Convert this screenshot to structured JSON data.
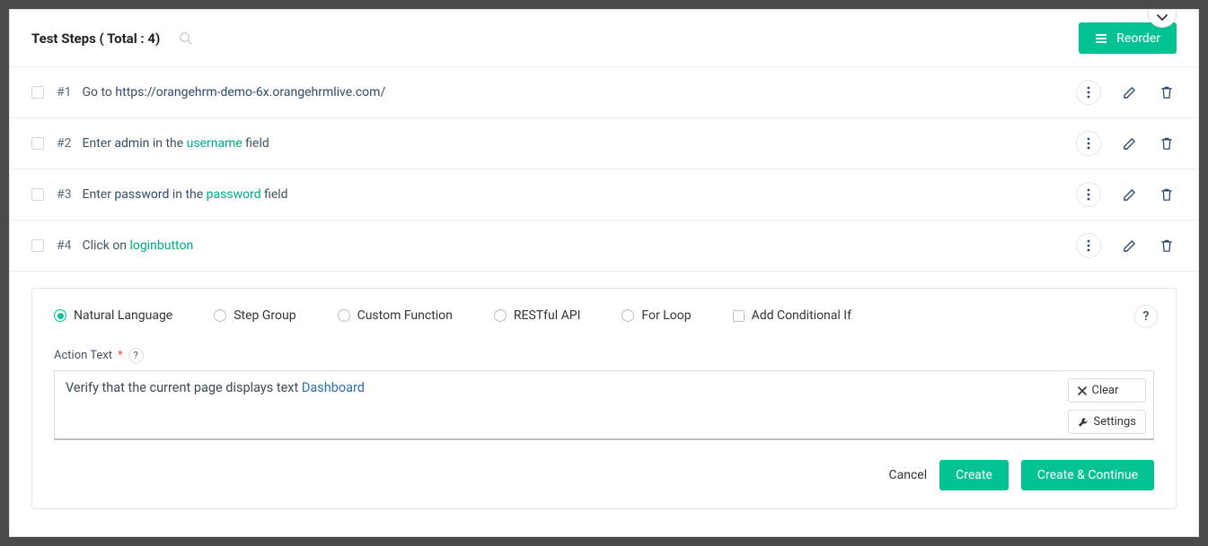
{
  "header": {
    "title": "Test Steps ( Total : 4)",
    "reorder_label": "Reorder"
  },
  "steps": [
    {
      "num": "#1",
      "pre": "Go to ",
      "link": "https://orangehrm-demo-6x.orangehrmlive.com/",
      "mid": "",
      "field": "",
      "post": ""
    },
    {
      "num": "#2",
      "pre": "Enter ",
      "link": "admin",
      "mid": " in the ",
      "field": "username",
      "post": " field"
    },
    {
      "num": "#3",
      "pre": "Enter ",
      "link": "password",
      "mid": " in the ",
      "field": "password",
      "post": " field"
    },
    {
      "num": "#4",
      "pre": "Click on ",
      "link": "",
      "mid": "",
      "field": "loginbutton",
      "post": ""
    }
  ],
  "type_options": {
    "natural_language": "Natural Language",
    "step_group": "Step Group",
    "custom_function": "Custom Function",
    "restful_api": "RESTful API",
    "for_loop": "For Loop",
    "conditional_if": "Add Conditional If"
  },
  "editor": {
    "label": "Action Text",
    "value_pre": "Verify that the current page displays text ",
    "value_hl": "Dashboard",
    "clear": "Clear",
    "settings": "Settings"
  },
  "footer": {
    "cancel": "Cancel",
    "create": "Create",
    "create_continue": "Create & Continue"
  },
  "icons": {
    "help": "?"
  }
}
